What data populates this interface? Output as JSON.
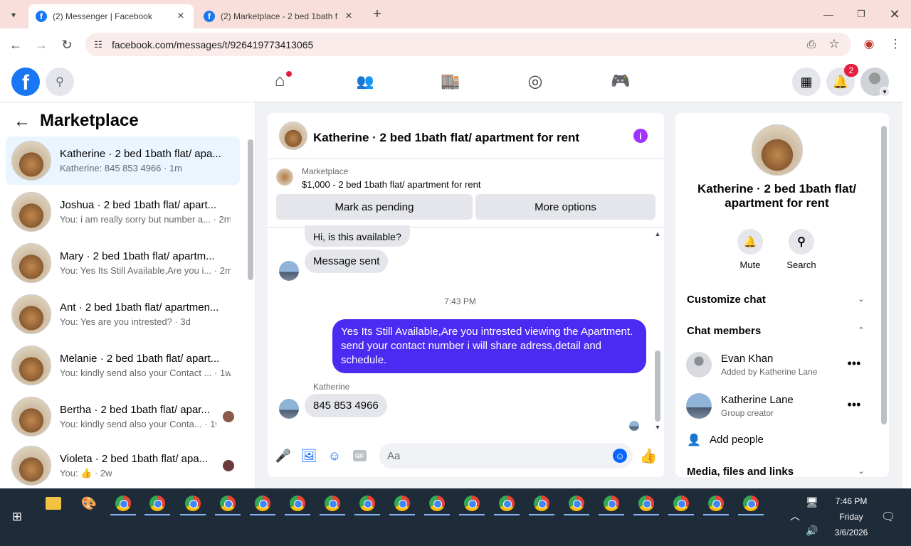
{
  "browser": {
    "tabs": [
      {
        "title": "(2) Messenger | Facebook",
        "active": true
      },
      {
        "title": "(2) Marketplace - 2 bed 1bath f",
        "active": false
      }
    ],
    "url": "facebook.com/messages/t/926419773413065"
  },
  "fb_header": {
    "notification_count": "2"
  },
  "sidebar": {
    "title": "Marketplace",
    "conversations": [
      {
        "name": "Katherine · 2 bed 1bath flat/ apa...",
        "preview": "Katherine: 845 853 4966 · 1m"
      },
      {
        "name": "Joshua · 2 bed 1bath flat/ apart...",
        "preview": "You: i am really sorry but number a... · 2m"
      },
      {
        "name": "Mary · 2 bed 1bath flat/ apartm...",
        "preview": "You: Yes Its Still Available,Are you i... · 2m"
      },
      {
        "name": "Ant · 2 bed 1bath flat/ apartmen...",
        "preview": "You: Yes are you intrested? · 3d"
      },
      {
        "name": "Melanie · 2 bed 1bath flat/ apart...",
        "preview": "You: kindly send also your Contact ... · 1w"
      },
      {
        "name": "Bertha · 2 bed 1bath flat/ apar...",
        "preview": "You: kindly send also your Conta... · 1w"
      },
      {
        "name": "Violeta · 2 bed 1bath flat/ apa...",
        "preview": "You: 👍 · 2w"
      }
    ]
  },
  "chat": {
    "title": "Katherine · 2 bed 1bath flat/ apartment for rent",
    "listing_label": "Marketplace",
    "listing_price_title": "$1,000 - 2 bed 1bath flat/ apartment for rent",
    "mark_pending": "Mark as pending",
    "more_options": "More options",
    "msg_partial": "Hi, is this available?",
    "msg_sent": "Message sent",
    "timestamp": "7:43 PM",
    "outgoing": "Yes Its Still Available,Are you intrested viewing the Apartment. send your contact number i will share adress,detail and schedule.",
    "sender_label": "Katherine",
    "incoming": "845 853 4966",
    "input_placeholder": "Aa"
  },
  "details": {
    "title": "Katherine · 2 bed 1bath flat/ apartment for rent",
    "mute": "Mute",
    "search": "Search",
    "customize": "Customize chat",
    "members_heading": "Chat members",
    "members": [
      {
        "name": "Evan Khan",
        "role": "Added by Katherine Lane"
      },
      {
        "name": "Katherine Lane",
        "role": "Group creator"
      }
    ],
    "add_people": "Add people",
    "media": "Media, files and links"
  },
  "taskbar": {
    "time": "7:46 PM",
    "day": "Friday",
    "date": "3/6/2026"
  },
  "colors": {
    "fb_blue": "#1877f2",
    "outgoing_bubble": "#4b2bf2",
    "purple_accent": "#a033ff"
  }
}
